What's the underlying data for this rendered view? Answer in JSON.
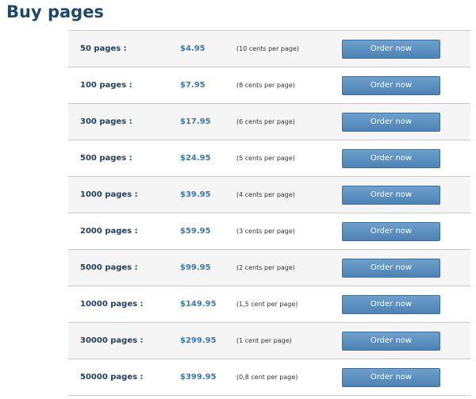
{
  "page": {
    "title": "Buy pages"
  },
  "pricing": {
    "rows": [
      {
        "pages": "50 pages :",
        "price": "$4.95",
        "per_page": "(10 cents per page)",
        "button": "Order now"
      },
      {
        "pages": "100 pages :",
        "price": "$7.95",
        "per_page": "(8 cents per page)",
        "button": "Order now"
      },
      {
        "pages": "300 pages :",
        "price": "$17.95",
        "per_page": "(6 cents per page)",
        "button": "Order now"
      },
      {
        "pages": "500 pages :",
        "price": "$24.95",
        "per_page": "(5 cents per page)",
        "button": "Order now"
      },
      {
        "pages": "1000 pages :",
        "price": "$39.95",
        "per_page": "(4 cents per page)",
        "button": "Order now"
      },
      {
        "pages": "2000 pages :",
        "price": "$59.95",
        "per_page": "(3 cents per page)",
        "button": "Order now"
      },
      {
        "pages": "5000 pages :",
        "price": "$99.95",
        "per_page": "(2 cents per page)",
        "button": "Order now"
      },
      {
        "pages": "10000 pages :",
        "price": "$149.95",
        "per_page": "(1,5 cent per page)",
        "button": "Order now"
      },
      {
        "pages": "30000 pages :",
        "price": "$299.95",
        "per_page": "(1 cent per page)",
        "button": "Order now"
      },
      {
        "pages": "50000 pages :",
        "price": "$399.95",
        "per_page": "(0,8 cent per page)",
        "button": "Order now"
      }
    ]
  },
  "colors": {
    "title": "#1f4868",
    "price": "#3a7ab0",
    "button": "#5a8fc0",
    "row_alt": "#f5f5f5"
  }
}
